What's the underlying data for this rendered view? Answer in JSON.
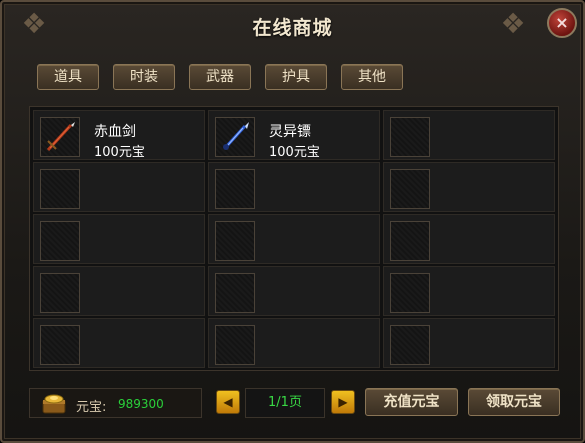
{
  "window": {
    "title": "在线商城",
    "close_label": "×"
  },
  "tabs": [
    {
      "label": "道具"
    },
    {
      "label": "时装"
    },
    {
      "label": "武器"
    },
    {
      "label": "护具"
    },
    {
      "label": "其他"
    }
  ],
  "items": [
    {
      "name": "赤血剑",
      "price": "100元宝",
      "icon": "red-sword-icon"
    },
    {
      "name": "灵异镖",
      "price": "100元宝",
      "icon": "blue-dart-icon"
    }
  ],
  "footer": {
    "currency_label": "元宝:",
    "currency_value": "989300",
    "currency_icon": "gold-ingot-chest-icon",
    "prev_label": "◀",
    "next_label": "▶",
    "page_text": "1/1页",
    "recharge_label": "充值元宝",
    "claim_label": "领取元宝"
  },
  "colors": {
    "currency_value": "#2ad03a",
    "page_text": "#39d845",
    "close_button": "#a8281f"
  }
}
